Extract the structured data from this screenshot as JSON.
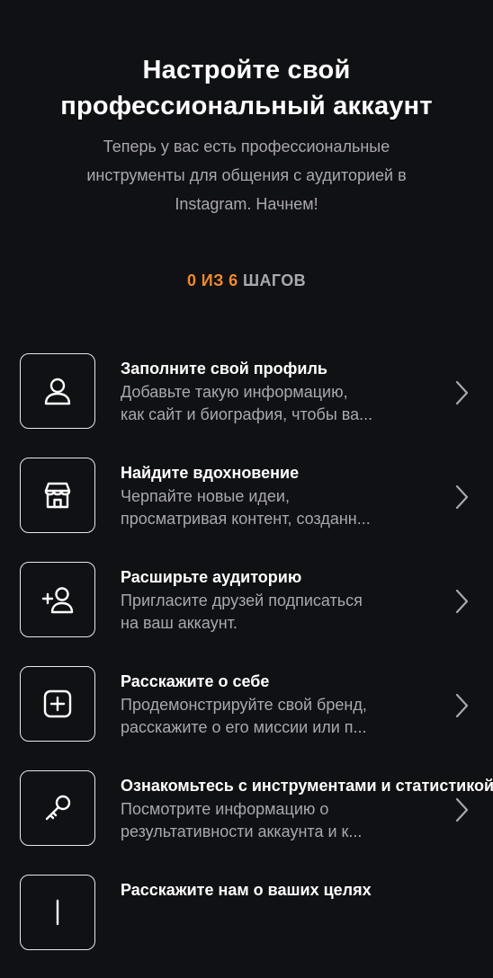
{
  "header": {
    "title_line1": "Настройте свой",
    "title_line2": "профессиональный аккаунт",
    "subtitle_line1": "Теперь у вас есть профессиональные",
    "subtitle_line2": "инструменты для общения с аудиторией в",
    "subtitle_line3": "Instagram. Начнем!"
  },
  "progress": {
    "count": "0 ИЗ 6",
    "word": "ШАГОВ"
  },
  "items": [
    {
      "icon": "person-icon",
      "title": "Заполните свой профиль",
      "desc1": "Добавьте такую информацию,",
      "desc2": "как сайт и биография, чтобы ва..."
    },
    {
      "icon": "shop-icon",
      "title": "Найдите вдохновение",
      "desc1": "Черпайте новые идеи,",
      "desc2": "просматривая контент, созданн..."
    },
    {
      "icon": "add-person-icon",
      "title": "Расширьте аудиторию",
      "desc1": "Пригласите друзей подписаться",
      "desc2": "на ваш аккаунт."
    },
    {
      "icon": "plus-square-icon",
      "title": "Расскажите о себе",
      "desc1": "Продемонстрируйте свой бренд,",
      "desc2": "расскажите о его миссии или п..."
    },
    {
      "icon": "key-icon",
      "title": "Ознакомьтесь с инструментами и статистикой",
      "desc1": "Посмотрите информацию о",
      "desc2": "результативности аккаунта и к..."
    },
    {
      "icon": "target-icon",
      "title": "Расскажите нам о ваших целях",
      "desc1": "",
      "desc2": ""
    }
  ],
  "colors": {
    "background": "#101114",
    "accent": "#f08a2c",
    "secondary_text": "#a8a8ad"
  }
}
